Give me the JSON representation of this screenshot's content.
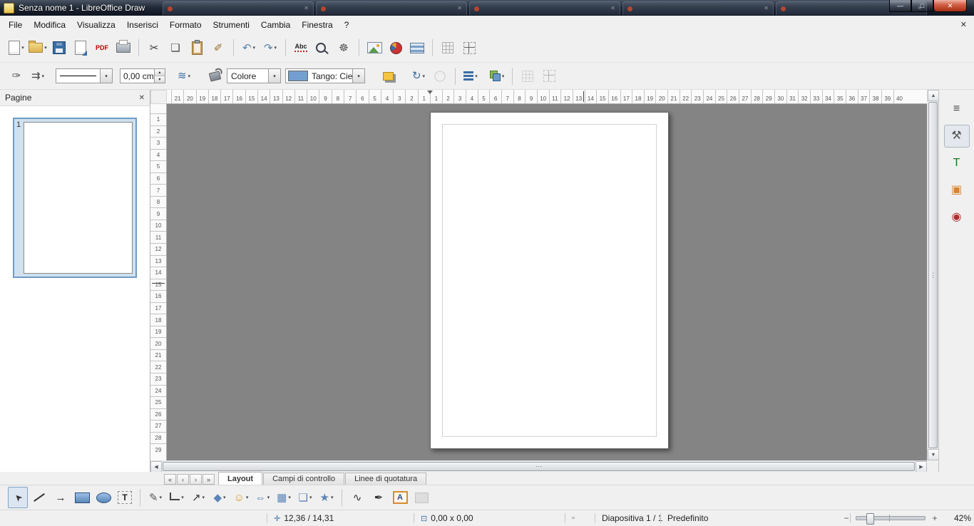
{
  "titlebar": {
    "title": "Senza nome 1 - LibreOffice Draw",
    "background_tab_count": 5
  },
  "window_controls": {
    "minimize": "—",
    "maximize": "□",
    "close": "✕"
  },
  "menu": {
    "items": [
      "File",
      "Modifica",
      "Visualizza",
      "Inserisci",
      "Formato",
      "Strumenti",
      "Cambia",
      "Finestra",
      "?"
    ],
    "close_document": "✕"
  },
  "standard_toolbar": {
    "items": [
      {
        "name": "new-document",
        "cls": "i-page",
        "dd": true
      },
      {
        "name": "open",
        "cls": "i-folder",
        "dd": true
      },
      {
        "name": "save",
        "cls": "i-floppy"
      },
      {
        "name": "export",
        "cls": "i-page pedit"
      },
      {
        "name": "export-pdf",
        "g": "PDF",
        "cls": "txticon",
        "c": "#c00000"
      },
      {
        "name": "print",
        "cls": "i-printer"
      },
      {
        "name": "cut",
        "g": "✂",
        "c": "#3a3a3a",
        "sep": true
      },
      {
        "name": "copy",
        "g": "❏",
        "c": "#4a4a4a"
      },
      {
        "name": "paste",
        "cls": "i-clipboard"
      },
      {
        "name": "clone-formatting",
        "g": "✐",
        "c": "#9a6a2a"
      },
      {
        "name": "undo",
        "g": "↶",
        "c": "#5a82a8",
        "dd": true,
        "sep": true
      },
      {
        "name": "redo",
        "g": "↷",
        "c": "#5a82a8",
        "dd": true
      },
      {
        "name": "spelling",
        "g": "Abc",
        "cls": "txticon spell",
        "c": "#222",
        "sep": true
      },
      {
        "name": "find-replace",
        "cls": "i-mag"
      },
      {
        "name": "navigator",
        "g": "☸",
        "c": "#555"
      },
      {
        "name": "insert-image",
        "cls": "i-picture",
        "sep": true
      },
      {
        "name": "insert-chart",
        "cls": "i-pie"
      },
      {
        "name": "insert-table",
        "cls": "i-table"
      },
      {
        "name": "display-grid",
        "cls": "i-grid",
        "sep": true
      },
      {
        "name": "helplines-while-moving",
        "cls": "i-helplines"
      }
    ]
  },
  "line_toolbar": {
    "line_width": "0,00 cm",
    "area_style": "Colore",
    "fill_color_name": "Tango: Cie",
    "fill_swatch_color": "#729fcf"
  },
  "pages_panel": {
    "title": "Pagine",
    "close_glyph": "✕",
    "page_number": "1"
  },
  "rulers": {
    "h_left": [
      "21",
      "20",
      "19",
      "18",
      "17",
      "16",
      "15",
      "14",
      "13",
      "12",
      "11",
      "10",
      "9",
      "8",
      "7",
      "6",
      "5",
      "4",
      "3",
      "2",
      "1"
    ],
    "h_right": [
      "1",
      "2",
      "3",
      "4",
      "5",
      "6",
      "7",
      "8",
      "9",
      "10",
      "11",
      "12",
      "13",
      "14",
      "15",
      "16",
      "17",
      "18",
      "19",
      "20",
      "21",
      "22",
      "23",
      "24",
      "25",
      "26",
      "27",
      "28",
      "29",
      "30",
      "31",
      "32",
      "33",
      "34",
      "35",
      "36",
      "37",
      "38",
      "39",
      "40"
    ],
    "v": [
      "1",
      "2",
      "3",
      "4",
      "5",
      "6",
      "7",
      "8",
      "9",
      "10",
      "11",
      "12",
      "13",
      "14",
      "15",
      "16",
      "17",
      "18",
      "19",
      "20",
      "21",
      "22",
      "23",
      "24",
      "25",
      "26",
      "27",
      "28",
      "29"
    ]
  },
  "page_tabs": {
    "nav": [
      "«",
      "‹",
      "›",
      "»"
    ],
    "tabs": [
      {
        "label": "Layout",
        "active": true
      },
      {
        "label": "Campi di controllo",
        "active": false
      },
      {
        "label": "Linee di quotatura",
        "active": false
      }
    ]
  },
  "drawing_toolbar": {
    "items": [
      {
        "name": "select-tool",
        "g": "➤",
        "cls": "i-cursor",
        "c": "#333",
        "pressed": true
      },
      {
        "name": "line-tool",
        "cls": "i-lineseg"
      },
      {
        "name": "line-arrow-tool",
        "g": "→",
        "c": "#222"
      },
      {
        "name": "rectangle-tool",
        "cls": "i-rect"
      },
      {
        "name": "ellipse-tool",
        "cls": "i-ellipse"
      },
      {
        "name": "text-tool",
        "g": "T",
        "cls": "i-textbox",
        "c": "#222"
      },
      {
        "name": "curve-tool",
        "g": "✎",
        "c": "#555",
        "dd": true,
        "sep": true
      },
      {
        "name": "connector-tool",
        "cls": "i-conn",
        "dd": true
      },
      {
        "name": "lines-arrows-tool",
        "g": "↗",
        "c": "#333",
        "dd": true
      },
      {
        "name": "basic-shapes-tool",
        "g": "◆",
        "c": "#5b84b8",
        "dd": true
      },
      {
        "name": "symbol-shapes-tool",
        "g": "☺",
        "c": "#d99a2b",
        "dd": true
      },
      {
        "name": "block-arrows-tool",
        "g": "⇔",
        "c": "#5b84b8",
        "dd": true
      },
      {
        "name": "flowchart-tool",
        "g": "▦",
        "c": "#5b84b8",
        "dd": true
      },
      {
        "name": "callouts-tool",
        "g": "❏",
        "c": "#5b84b8",
        "dd": true
      },
      {
        "name": "stars-tool",
        "g": "★",
        "c": "#5b84b8",
        "dd": true
      },
      {
        "name": "points-tool",
        "g": "∿",
        "c": "#333",
        "sep": true
      },
      {
        "name": "glue-points-tool",
        "g": "✒",
        "c": "#333"
      },
      {
        "name": "fontwork-tool",
        "g": "A",
        "cls": "i-fontwork",
        "c": "#2a4d7a"
      },
      {
        "name": "insert-image-tool",
        "cls": "i-imgframe",
        "disabled": true
      }
    ]
  },
  "sidebar": {
    "items": [
      {
        "name": "sidebar-settings",
        "glyph": "≡",
        "color": "#444"
      },
      {
        "name": "properties",
        "glyph": "⚒",
        "color": "#555",
        "active": true
      },
      {
        "name": "styles",
        "glyph": "T",
        "color": "#1a7a1a"
      },
      {
        "name": "gallery",
        "glyph": "▣",
        "color": "#d9822b"
      },
      {
        "name": "navigator",
        "glyph": "◉",
        "color": "#b03030"
      }
    ]
  },
  "statusbar": {
    "position": "12,36 / 14,31",
    "object_size": "0,00 x 0,00",
    "slide": "Diapositiva 1 / 1",
    "page_style": "Predefinito",
    "zoom": "42%",
    "zoom_out": "−",
    "zoom_in": "+",
    "position_icon": "✛",
    "size_icon": "⊡",
    "modified_icon": "▫"
  },
  "scrollbars": {
    "up": "▲",
    "down": "▼",
    "left": "◀",
    "right": "▶",
    "grip_h": "⋯",
    "grip_v": "⋮"
  },
  "icons": {
    "dd": "▾",
    "spin_up": "▴",
    "spin_down": "▾",
    "edit_points": "✑",
    "arrow_style": "⇉",
    "line_color": "≋",
    "transform": "↻",
    "extrusion": "◯",
    "close_small": "✕"
  },
  "colors": {
    "canvas": "#848484",
    "selection_border": "#6f9bc4",
    "accent": "#3a6ea5"
  }
}
